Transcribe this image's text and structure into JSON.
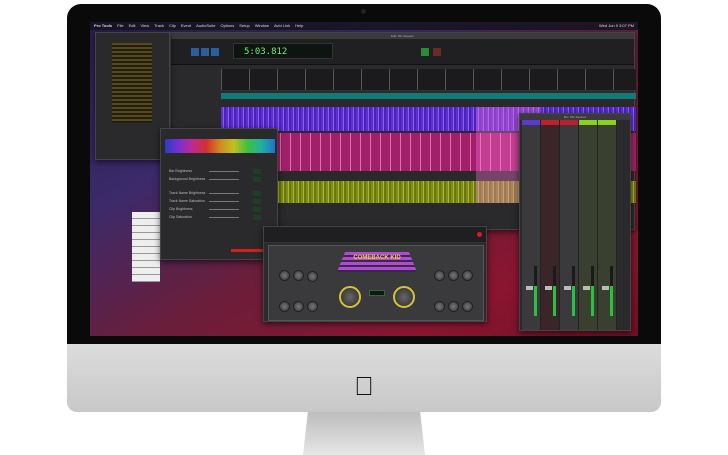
{
  "menubar": {
    "items": [
      "Pro Tools",
      "File",
      "Edit",
      "View",
      "Track",
      "Clip",
      "Event",
      "AudioSuite",
      "Options",
      "Setup",
      "Window",
      "Avid Link",
      "Help"
    ],
    "clock": "Wed Jun 9 3:07 PM"
  },
  "edit_window": {
    "title": "Edit: Mix Session",
    "counter": "5:03.812"
  },
  "color_prefs": {
    "rows": [
      "Bar Brightness",
      "Background Brightness",
      "Track Name Brightness",
      "Track Name Saturation",
      "Clip Brightness",
      "Clip Saturation"
    ]
  },
  "plugin": {
    "name": "COMEBACK KID"
  },
  "mixer": {
    "title": "Mix: Mix Session",
    "strip_colors": [
      "#5a3ad0",
      "#c0202a",
      "#b82030",
      "#8ad020",
      "#8ad020"
    ]
  }
}
